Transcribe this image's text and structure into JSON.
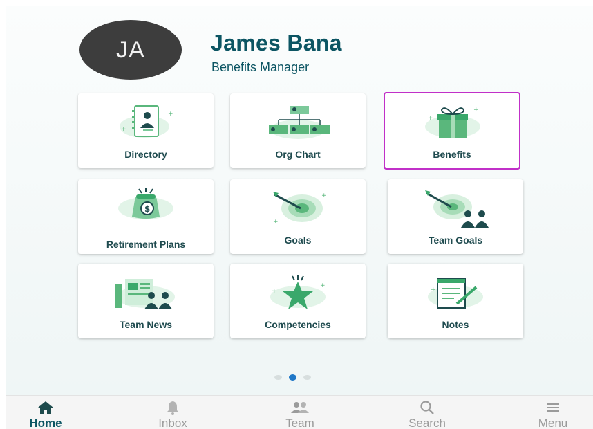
{
  "profile": {
    "initials": "JA",
    "name": "James Bana",
    "role": "Benefits Manager"
  },
  "tiles": [
    {
      "label": "Directory",
      "icon": "directory-icon"
    },
    {
      "label": "Org Chart",
      "icon": "org-chart-icon"
    },
    {
      "label": "Benefits",
      "icon": "gift-icon",
      "selected": true
    },
    {
      "label": "Retirement Plans",
      "icon": "money-bag-icon"
    },
    {
      "label": "Goals",
      "icon": "target-icon"
    },
    {
      "label": "Team Goals",
      "icon": "team-target-icon"
    },
    {
      "label": "Team News",
      "icon": "news-icon"
    },
    {
      "label": "Competencies",
      "icon": "star-icon"
    },
    {
      "label": "Notes",
      "icon": "notepad-icon"
    }
  ],
  "pager": {
    "pages": 3,
    "current": 2
  },
  "nav": [
    {
      "label": "Home",
      "icon": "home-icon",
      "active": true
    },
    {
      "label": "Inbox",
      "icon": "bell-icon"
    },
    {
      "label": "Team",
      "icon": "team-icon"
    },
    {
      "label": "Search",
      "icon": "search-icon"
    },
    {
      "label": "Menu",
      "icon": "menu-icon"
    }
  ],
  "colors": {
    "primary": "#0c5563",
    "accent_green": "#3aa86b",
    "selected_border": "#c130c8",
    "active_dot": "#1f77c7"
  }
}
